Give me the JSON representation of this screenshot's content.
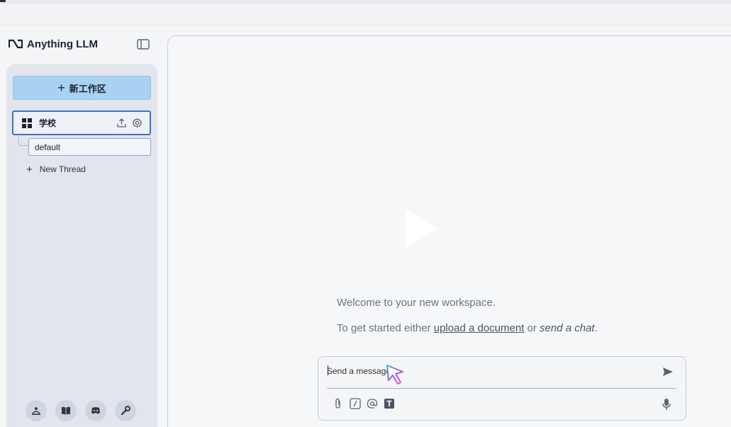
{
  "app": {
    "title": "Anything LLM"
  },
  "sidebar": {
    "new_workspace_label": "新工作区",
    "workspace": {
      "name": "学校",
      "threads": [
        {
          "label": "default"
        }
      ]
    },
    "new_thread_label": "New Thread",
    "footer_icons": [
      "community-hub-icon",
      "docs-book-icon",
      "discord-icon",
      "settings-wrench-icon"
    ]
  },
  "main": {
    "welcome_text": "Welcome to your new workspace.",
    "getstarted_prefix": "To get started either",
    "upload_link": "upload a document",
    "or_text": "or",
    "send_chat_text": "send a chat",
    "period": "."
  },
  "composer": {
    "placeholder": "Send a message",
    "tool_icons": [
      "paperclip-icon",
      "slash-command-icon",
      "mention-at-icon",
      "text-format-icon"
    ]
  },
  "colors": {
    "accent": "#a9d1f2",
    "active_border": "#3b73c9",
    "sidebar_bg": "#e2e6ec"
  }
}
